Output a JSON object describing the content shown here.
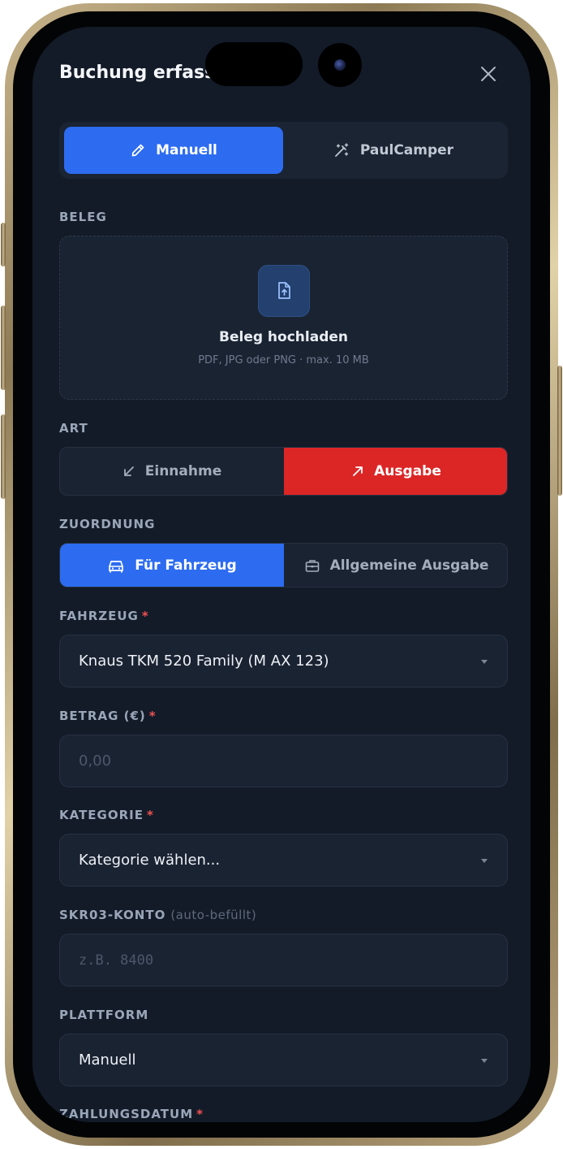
{
  "header": {
    "title": "Buchung erfassen"
  },
  "mode_tabs": {
    "manual": "Manuell",
    "paulcamper": "PaulCamper",
    "selected": "Manuell"
  },
  "beleg": {
    "label": "BELEG",
    "upload_title": "Beleg hochladen",
    "upload_hint": "PDF, JPG oder PNG · max. 10 MB"
  },
  "art": {
    "label": "ART",
    "einnahme": "Einnahme",
    "ausgabe": "Ausgabe",
    "selected": "Ausgabe"
  },
  "zuordnung": {
    "label": "ZUORDNUNG",
    "fahrzeug": "Für Fahrzeug",
    "allgemein": "Allgemeine Ausgabe",
    "selected": "Für Fahrzeug"
  },
  "fahrzeug": {
    "label": "FAHRZEUG",
    "required": "*",
    "value": "Knaus TKM 520 Family (M AX 123)"
  },
  "betrag": {
    "label": "BETRAG (€)",
    "required": "*",
    "placeholder": "0,00"
  },
  "kategorie": {
    "label": "KATEGORIE",
    "required": "*",
    "value": "Kategorie wählen..."
  },
  "skr03": {
    "label": "SKR03-KONTO",
    "hint": "(auto-befüllt)",
    "placeholder": "z.B. 8400"
  },
  "plattform": {
    "label": "PLATTFORM",
    "value": "Manuell"
  },
  "zahlungsdatum": {
    "label": "ZAHLUNGSDATUM",
    "required": "*"
  },
  "colors": {
    "background": "#131b28",
    "primary": "#2d6cf0",
    "danger": "#dc2626",
    "required": "#f05252"
  }
}
